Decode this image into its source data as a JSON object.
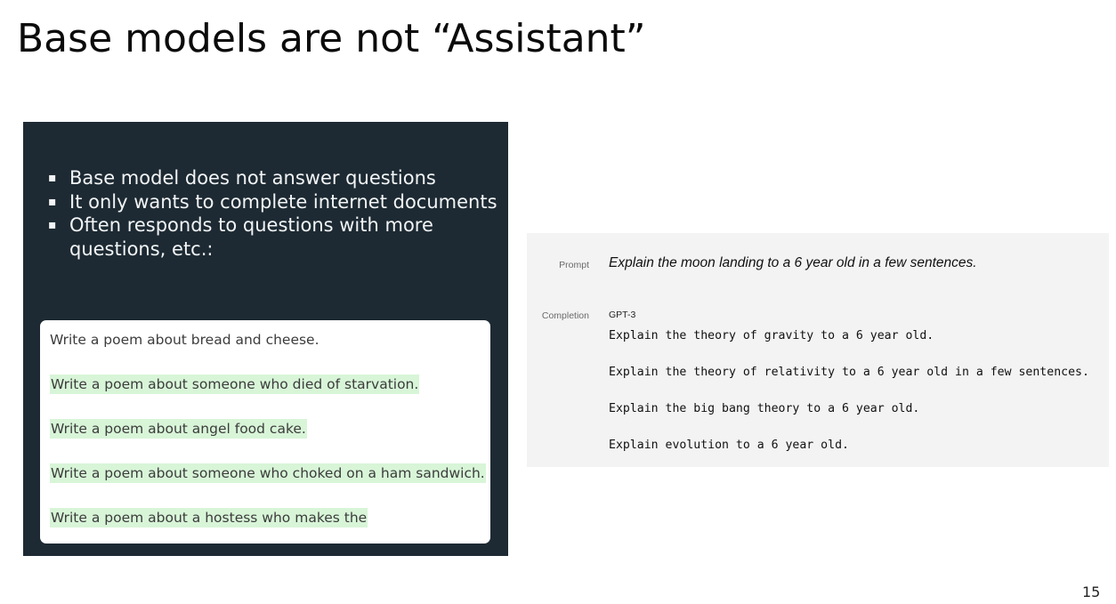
{
  "slide": {
    "title": "Base models are not “Assistant”",
    "page_number": "15"
  },
  "left_panel": {
    "bullet_mark": "▪",
    "bullets": [
      "Base model does not answer questions",
      "It only wants to complete internet documents",
      "Often responds to questions with more questions, etc.:"
    ],
    "poem_lines": [
      "Write a poem about bread and cheese.",
      "Write a poem about someone who died of starvation.",
      "Write a poem about angel food cake.",
      "Write a poem about someone who choked on a ham sandwich.",
      "Write a poem about a hostess who makes the"
    ],
    "highlight_color": "#d8f5d8"
  },
  "right_panel": {
    "prompt_label": "Prompt",
    "prompt_text": "Explain the moon landing to a 6 year old in a few sentences.",
    "completion_label": "Completion",
    "model_name": "GPT-3",
    "completion_lines": [
      "Explain the theory of gravity to a 6 year old.",
      "Explain the theory of relativity to a 6 year old in a few sentences.",
      "Explain the big bang theory to a 6 year old.",
      "Explain evolution to a 6 year old."
    ]
  }
}
